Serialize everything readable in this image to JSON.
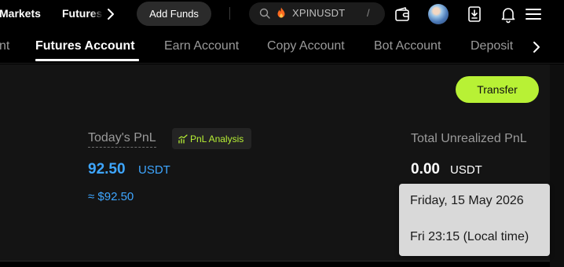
{
  "header": {
    "nav": {
      "markets": "Markets",
      "futures": "Futures"
    },
    "add_funds": "Add Funds",
    "search": {
      "value": "XPINUSDT",
      "shortcut": "/"
    },
    "icons": [
      "search-icon",
      "fire-icon",
      "wallet-icon",
      "avatar",
      "download-icon",
      "bell-icon",
      "menu-icon"
    ]
  },
  "tabs": {
    "items": [
      {
        "label": "nt"
      },
      {
        "label": "Futures Account",
        "active": true
      },
      {
        "label": "Earn Account"
      },
      {
        "label": "Copy Account"
      },
      {
        "label": "Bot Account"
      },
      {
        "label": "Deposit"
      }
    ]
  },
  "main": {
    "transfer": "Transfer",
    "todays_pnl": {
      "label": "Today's PnL",
      "analysis": "PnL Analysis",
      "value": "92.50",
      "unit": "USDT",
      "approx": "≈ $92.50"
    },
    "unrealized_pnl": {
      "label": "Total Unrealized PnL",
      "value": "0.00",
      "unit": "USDT"
    },
    "tooltip": {
      "date": "Friday, 15 May 2026",
      "time": "Fri 23:15 (Local time)"
    }
  },
  "colors": {
    "accent_green": "#b8f135",
    "pnl_blue": "#3ea6ff",
    "panel_bg": "#141414",
    "page_bg": "#000000",
    "tooltip_bg": "#d9d9d9"
  }
}
